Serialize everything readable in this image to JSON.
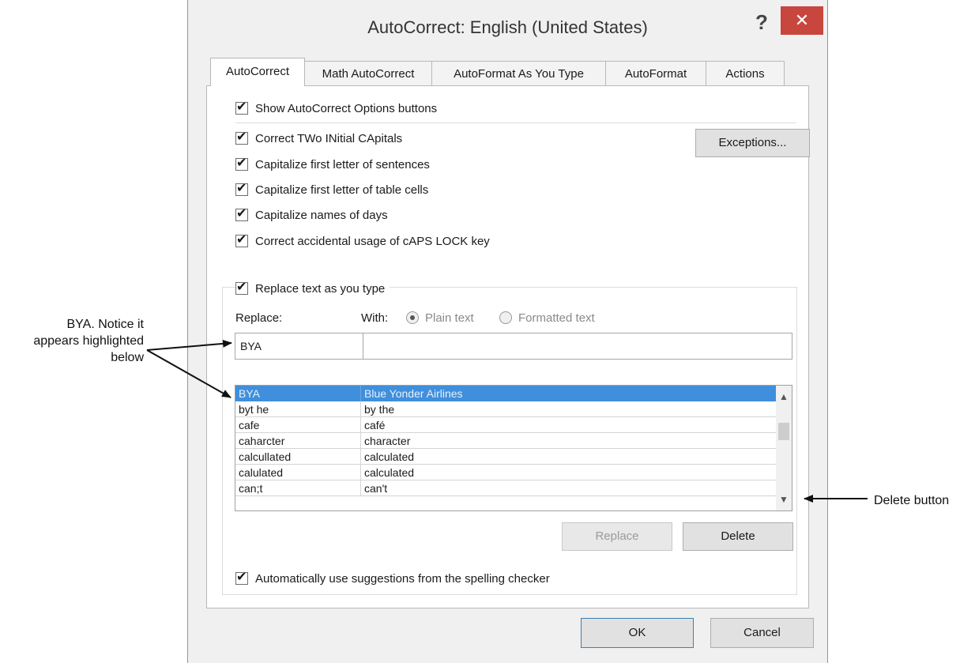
{
  "callouts": {
    "left_line1": "BYA. Notice it",
    "left_line2": "appears highlighted",
    "left_line3": "below",
    "right": "Delete button"
  },
  "dialog": {
    "title": "AutoCorrect: English (United States)",
    "help": "?",
    "close": "✕"
  },
  "tabs": [
    {
      "label": "AutoCorrect",
      "active": true
    },
    {
      "label": "Math AutoCorrect"
    },
    {
      "label": "AutoFormat As You Type"
    },
    {
      "label": "AutoFormat"
    },
    {
      "label": "Actions"
    }
  ],
  "options": {
    "show_buttons": "Show AutoCorrect Options buttons",
    "two_initial": "Correct TWo INitial CApitals",
    "first_letter_sentences": "Capitalize first letter of sentences",
    "first_letter_cells": "Capitalize first letter of table cells",
    "names_of_days": "Capitalize names of days",
    "caps_lock": "Correct accidental usage of cAPS LOCK key",
    "replace_as_you_type": "Replace text as you type",
    "spelling_suggestions": "Automatically use suggestions from the spelling checker"
  },
  "buttons": {
    "exceptions": "Exceptions...",
    "replace": "Replace",
    "delete": "Delete",
    "ok": "OK",
    "cancel": "Cancel"
  },
  "replace_section": {
    "replace_label": "Replace:",
    "with_label": "With:",
    "plain_text": "Plain text",
    "formatted_text": "Formatted text",
    "replace_value": "BYA",
    "with_value": ""
  },
  "entries": [
    {
      "from": "BYA",
      "to": "Blue Yonder Airlines",
      "selected": true
    },
    {
      "from": "byt he",
      "to": "by the"
    },
    {
      "from": "cafe",
      "to": "café"
    },
    {
      "from": "caharcter",
      "to": "character"
    },
    {
      "from": "calcullated",
      "to": "calculated"
    },
    {
      "from": "calulated",
      "to": "calculated"
    },
    {
      "from": "can;t",
      "to": "can't"
    }
  ]
}
